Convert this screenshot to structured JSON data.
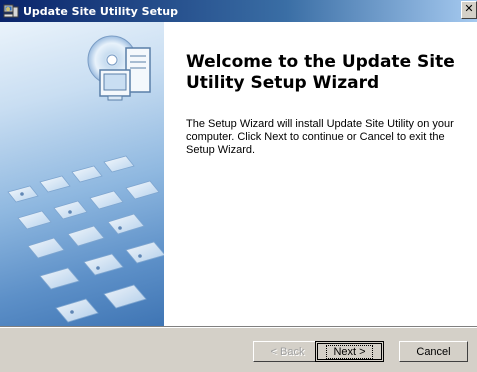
{
  "window": {
    "title": "Update Site Utility Setup",
    "close_label": "✕"
  },
  "wizard": {
    "heading": "Welcome to the Update Site Utility Setup Wizard",
    "body": "The Setup Wizard will install Update Site Utility on your computer.  Click Next to continue or Cancel to exit the Setup Wizard."
  },
  "buttons": {
    "back": "< Back",
    "next": "Next >",
    "cancel": "Cancel"
  },
  "colors": {
    "titlebar_start": "#0a246a",
    "titlebar_end": "#a6caf0",
    "dialog_face": "#d4d0c8"
  },
  "icons": {
    "app": "setup-computer-icon",
    "banner": "computer-cd-keyboard-banner"
  }
}
